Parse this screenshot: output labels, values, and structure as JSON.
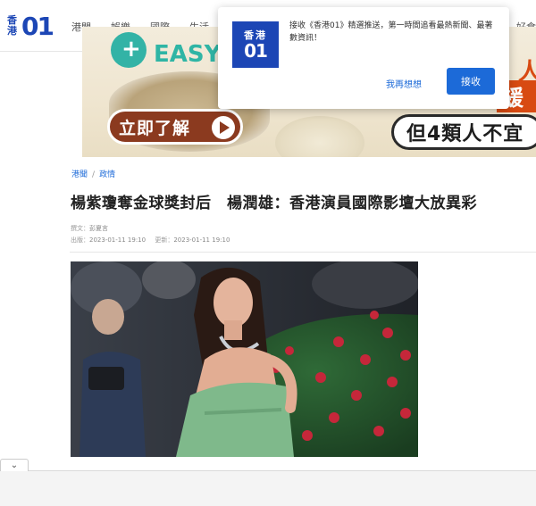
{
  "nav": {
    "logo_chars": [
      "香",
      "港"
    ],
    "logo_num": "01",
    "items": [
      "港聞",
      "娛樂",
      "國際",
      "生活"
    ],
    "right_item": "好食"
  },
  "ad": {
    "brand_text": "EASY",
    "cta": "立即了解",
    "right_top": "人",
    "right_mid": "緩",
    "tag": "但4類人不宜"
  },
  "popup": {
    "logo_chars": "香港",
    "logo_num": "01",
    "message": "接收《香港01》精選推送，第一時間追看最熱新聞、最著數資訊！",
    "later": "我再想想",
    "accept": "接收"
  },
  "article": {
    "breadcrumb": [
      "港聞",
      "政情"
    ],
    "title": "楊紫瓊奪金球獎封后　楊潤雄：香港演員國際影壇大放異彩",
    "author_label": "撰文：",
    "author": "彭夏言",
    "published_label": "出版：",
    "published": "2023-01-11 19:10",
    "updated_label": "更新：",
    "updated": "2023-01-11 19:10"
  },
  "colors": {
    "brand_blue": "#1c46b5",
    "link_blue": "#1c6ad8",
    "dress_green": "#7fb98b"
  },
  "icons": {
    "scroll_tab": "chevron-down-icon"
  }
}
